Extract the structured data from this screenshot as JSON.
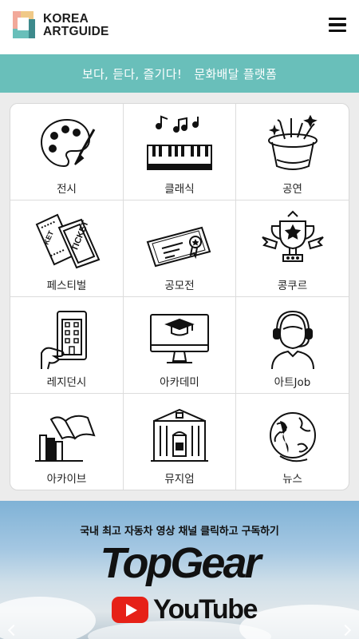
{
  "header": {
    "logo_line1": "KOREA",
    "logo_line2": "ARTGUIDE",
    "menu_icon": "hamburger-menu-icon"
  },
  "banner": {
    "text": "보다, 듣다, 즐기다!   문화배달 플랫폼"
  },
  "menu": [
    {
      "label": "전시",
      "icon": "palette-icon"
    },
    {
      "label": "클래식",
      "icon": "piano-icon"
    },
    {
      "label": "공연",
      "icon": "magic-hat-icon"
    },
    {
      "label": "페스티벌",
      "icon": "tickets-icon"
    },
    {
      "label": "공모전",
      "icon": "certificate-icon"
    },
    {
      "label": "콩쿠르",
      "icon": "trophy-icon"
    },
    {
      "label": "레지던시",
      "icon": "building-tablet-icon"
    },
    {
      "label": "아카데미",
      "icon": "graduation-monitor-icon"
    },
    {
      "label": "아트Job",
      "icon": "headset-agent-icon"
    },
    {
      "label": "아카이브",
      "icon": "books-icon"
    },
    {
      "label": "뮤지엄",
      "icon": "museum-icon"
    },
    {
      "label": "뉴스",
      "icon": "globe-icon"
    }
  ],
  "ad": {
    "caption": "국내 최고 자동차 영상 채널 클릭하고 구독하기",
    "brand": "TopGear",
    "platform": "YouTube",
    "colors": {
      "youtube_red": "#e62117",
      "banner": "#69bfba"
    }
  }
}
